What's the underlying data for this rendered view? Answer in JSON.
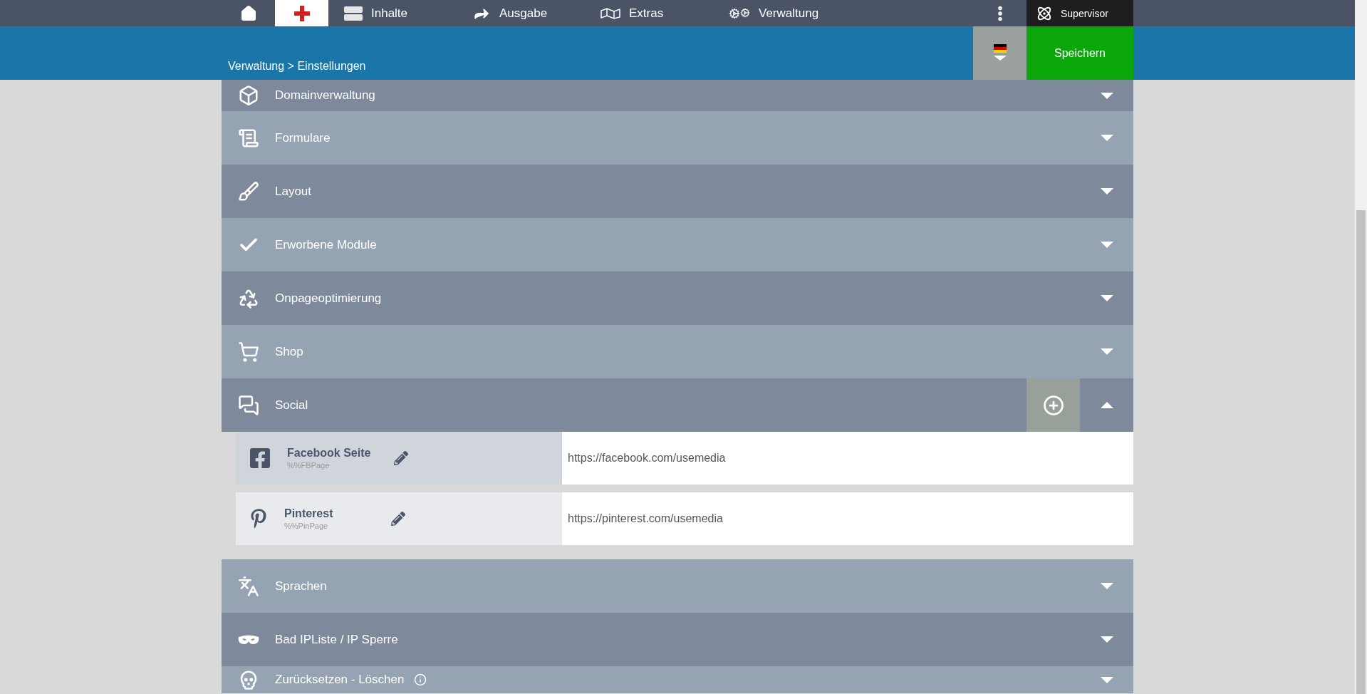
{
  "nav": {
    "tabs": [
      {
        "kind": "home",
        "selected": false
      },
      {
        "kind": "add",
        "selected": true
      },
      {
        "kind": "content",
        "label": "Inhalte",
        "selected": false
      },
      {
        "kind": "output",
        "label": "Ausgabe",
        "selected": false
      },
      {
        "kind": "extras",
        "label": "Extras",
        "selected": false
      },
      {
        "kind": "admin",
        "label": "Verwaltung",
        "selected": false
      }
    ],
    "user": "Supervisor"
  },
  "breadcrumb": "Verwaltung > Einstellungen",
  "save_button": "Speichern",
  "sections": [
    {
      "kind": "domain",
      "label": "Domainverwaltung",
      "expanded": false
    },
    {
      "kind": "forms",
      "label": "Formulare",
      "expanded": false
    },
    {
      "kind": "layout",
      "label": "Layout",
      "expanded": false
    },
    {
      "kind": "modules",
      "label": "Erworbene Module",
      "expanded": false
    },
    {
      "kind": "onpage",
      "label": "Onpageoptimierung",
      "expanded": false
    },
    {
      "kind": "shop",
      "label": "Shop",
      "expanded": false
    },
    {
      "kind": "social",
      "label": "Social",
      "expanded": true,
      "entries": [
        {
          "kind": "facebook",
          "name": "Facebook Seite",
          "variable": "%%FBPage",
          "value": "https://facebook.com/usemedia"
        },
        {
          "kind": "pinterest",
          "name": "Pinterest",
          "variable": "%%PinPage",
          "value": "https://pinterest.com/usemedia"
        }
      ]
    },
    {
      "kind": "languages",
      "label": "Sprachen",
      "expanded": false
    },
    {
      "kind": "blocklist",
      "label": "Bad IPListe / IP Sperre",
      "expanded": false
    },
    {
      "kind": "reset",
      "label": "Zurücksetzen - Löschen",
      "expanded": false,
      "info": true
    }
  ]
}
